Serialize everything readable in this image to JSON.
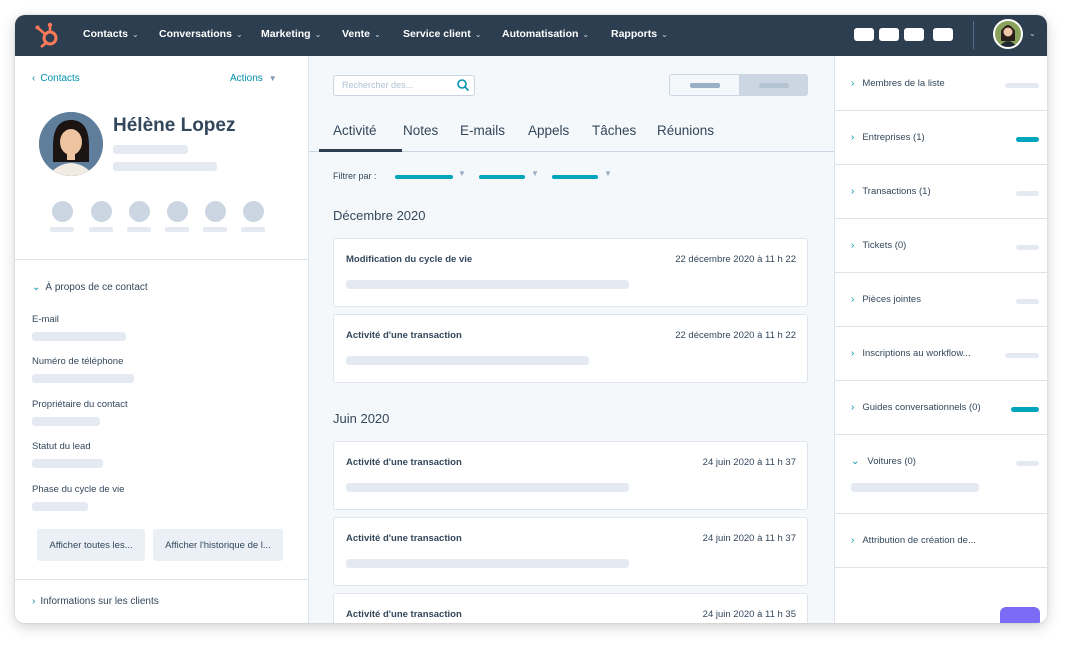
{
  "nav": {
    "items": [
      "Contacts",
      "Conversations",
      "Marketing",
      "Vente",
      "Service client",
      "Automatisation",
      "Rapports"
    ],
    "chevron": "⌄",
    "colors": {
      "bar": "#2d3e50",
      "logo": "#ff7a59"
    }
  },
  "contact": {
    "back": "Contacts",
    "actions": "Actions",
    "name": "Hélène Lopez"
  },
  "about": {
    "heading": "À propos de ce contact",
    "fields": [
      "E-mail",
      "Numéro de téléphone",
      "Propriétaire du contact",
      "Statut du lead",
      "Phase du cycle de vie"
    ],
    "btn_all": "Afficher toutes les...",
    "btn_history": "Afficher l'historique de l..."
  },
  "clients_info": "Informations sur les clients",
  "search": {
    "placeholder": "Rechercher des..."
  },
  "tabs": [
    "Activité",
    "Notes",
    "E-mails",
    "Appels",
    "Tâches",
    "Réunions"
  ],
  "filter_label": "Filtrer par :",
  "timeline": {
    "month1": "Décembre 2020",
    "month2": "Juin 2020",
    "cards": [
      {
        "title": "Modification du cycle de vie",
        "date": "22 décembre 2020 à 11 h 22"
      },
      {
        "title": "Activité d'une transaction",
        "date": "22 décembre 2020 à 11 h 22"
      },
      {
        "title": "Activité d'une transaction",
        "date": "24 juin 2020 à 11 h 37"
      },
      {
        "title": "Activité d'une transaction",
        "date": "24 juin 2020 à 11 h 37"
      },
      {
        "title": "Activité d'une transaction",
        "date": "24 juin 2020 à 11 h 35"
      }
    ]
  },
  "sidebar": {
    "items": [
      "Membres de la liste",
      "Entreprises (1)",
      "Transactions (1)",
      "Tickets (0)",
      "Pièces jointes",
      "Inscriptions au workflow...",
      "Guides conversationnels (0)",
      "Voitures (0)",
      "Attribution de création de..."
    ],
    "collapsed_chevron": "›",
    "expanded_chevron": "⌄"
  }
}
